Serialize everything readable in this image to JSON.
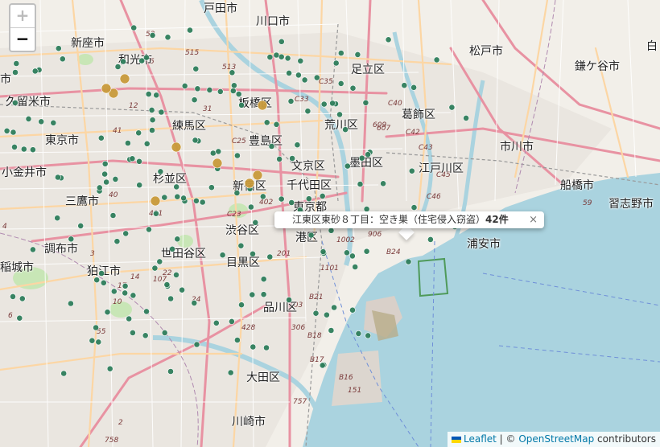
{
  "map": {
    "places": [
      {
        "id": "todashi",
        "text": "戸田市"
      },
      {
        "id": "kawaguchi",
        "text": "川口市"
      },
      {
        "id": "niiza",
        "text": "新座市"
      },
      {
        "id": "wako",
        "text": "和光市"
      },
      {
        "id": "matsudo",
        "text": "松戸市"
      },
      {
        "id": "kamagaya",
        "text": "鎌ケ谷市"
      },
      {
        "id": "shiro",
        "text": "白"
      },
      {
        "id": "ichi",
        "text": "市"
      },
      {
        "id": "kurume",
        "text": "久留米市"
      },
      {
        "id": "adachi",
        "text": "足立区"
      },
      {
        "id": "itabashi",
        "text": "板橋区"
      },
      {
        "id": "katsushika",
        "text": "葛飾区"
      },
      {
        "id": "nerima",
        "text": "練馬区"
      },
      {
        "id": "arakawa",
        "text": "荒川区"
      },
      {
        "id": "higashikurume",
        "text": "東京市"
      },
      {
        "id": "toshima",
        "text": "豊島区"
      },
      {
        "id": "ichikawa",
        "text": "市川市"
      },
      {
        "id": "bunkyo",
        "text": "文京区"
      },
      {
        "id": "sumida",
        "text": "墨田区"
      },
      {
        "id": "edogawa",
        "text": "江戸川区"
      },
      {
        "id": "koganei",
        "text": "小金井市"
      },
      {
        "id": "suginami",
        "text": "杉並区"
      },
      {
        "id": "funabashi",
        "text": "船橋市"
      },
      {
        "id": "chiyoda",
        "text": "千代田区"
      },
      {
        "id": "mitaka",
        "text": "三鷹市"
      },
      {
        "id": "shinjuku",
        "text": "新宿区"
      },
      {
        "id": "tokyo",
        "text": "東京都"
      },
      {
        "id": "narashino",
        "text": "習志野市"
      },
      {
        "id": "chofu",
        "text": "調布市"
      },
      {
        "id": "shibuya",
        "text": "渋谷区"
      },
      {
        "id": "minato",
        "text": "港区"
      },
      {
        "id": "urayasu",
        "text": "浦安市"
      },
      {
        "id": "inagi",
        "text": "稲城市"
      },
      {
        "id": "setagaya",
        "text": "世田谷区"
      },
      {
        "id": "komae",
        "text": "狛江市"
      },
      {
        "id": "meguro",
        "text": "目黒区"
      },
      {
        "id": "shinagawa",
        "text": "品川区"
      },
      {
        "id": "ota",
        "text": "大田区"
      },
      {
        "id": "kawasaki",
        "text": "川崎市"
      }
    ],
    "road_labels": [
      "515",
      "52",
      "513",
      "C35",
      "C33",
      "C40",
      "607",
      "C42",
      "C43",
      "609",
      "C25",
      "C45",
      "C46",
      "41",
      "411",
      "40",
      "C23",
      "402",
      "1002",
      "906",
      "B24",
      "201",
      "1101",
      "B21",
      "103",
      "B18",
      "B17",
      "B16",
      "151",
      "757",
      "758",
      "2",
      "14",
      "3",
      "4",
      "55",
      "59",
      "5",
      "6",
      "12",
      "24",
      "22",
      "31",
      "10",
      "306",
      "107",
      "428",
      "17"
    ],
    "markers": [
      {
        "kind": "green",
        "count": 204
      },
      {
        "kind": "gold",
        "count": 9
      }
    ],
    "colors": {
      "land": "#f2efe9",
      "water": "#aad3df",
      "marker_green": "#2e7d5b",
      "marker_gold": "#c89a3a",
      "road_major": "#e892a2",
      "road_primary": "#fcd6a4",
      "road_minor": "#ffffff",
      "park": "#c8e6b6",
      "rail": "#999999"
    }
  },
  "controls": {
    "zoom_in": "+",
    "zoom_out": "−"
  },
  "popup": {
    "text": "江東区東砂８丁目：空き巣（住宅侵入窃盗）",
    "count": "42件",
    "close": "×"
  },
  "attribution": {
    "leaflet": "Leaflet",
    "separator": " | © ",
    "osm": "OpenStreetMap",
    "suffix": " contributors"
  }
}
